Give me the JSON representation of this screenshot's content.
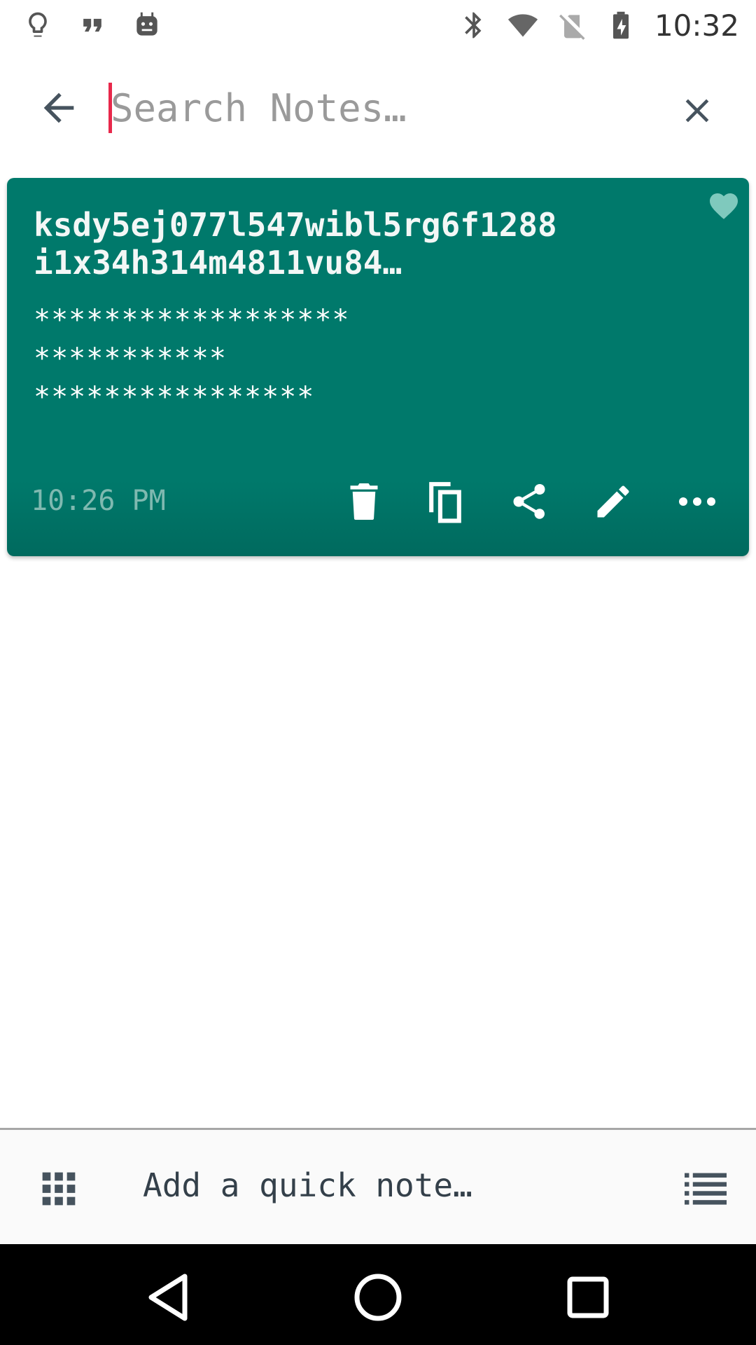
{
  "status_bar": {
    "time": "10:32",
    "left_icons": [
      "lightbulb-icon",
      "quote-icon",
      "android-icon"
    ],
    "right_icons": [
      "bluetooth-icon",
      "wifi-icon",
      "no-sim-icon",
      "battery-charging-icon"
    ]
  },
  "search": {
    "placeholder": "Search Notes…",
    "value": "",
    "back_icon": "arrow-back-icon",
    "clear_icon": "close-icon"
  },
  "notes": [
    {
      "title_lines": [
        "ksdy5ej077l547wibl5rg6f1288",
        "i1x34h314m4811vu84…"
      ],
      "body_lines": [
        "******************",
        "***********",
        "****************"
      ],
      "time": "10:26 PM",
      "favorite": true,
      "actions": [
        "delete-icon",
        "copy-icon",
        "share-icon",
        "edit-icon",
        "more-icon"
      ]
    }
  ],
  "quick_note": {
    "placeholder": "Add a quick note…",
    "left_icon": "grid-icon",
    "right_icon": "list-icon"
  },
  "colors": {
    "card": "#00796b",
    "cursor": "#e8284b",
    "time_text": "#7fb9b0"
  }
}
